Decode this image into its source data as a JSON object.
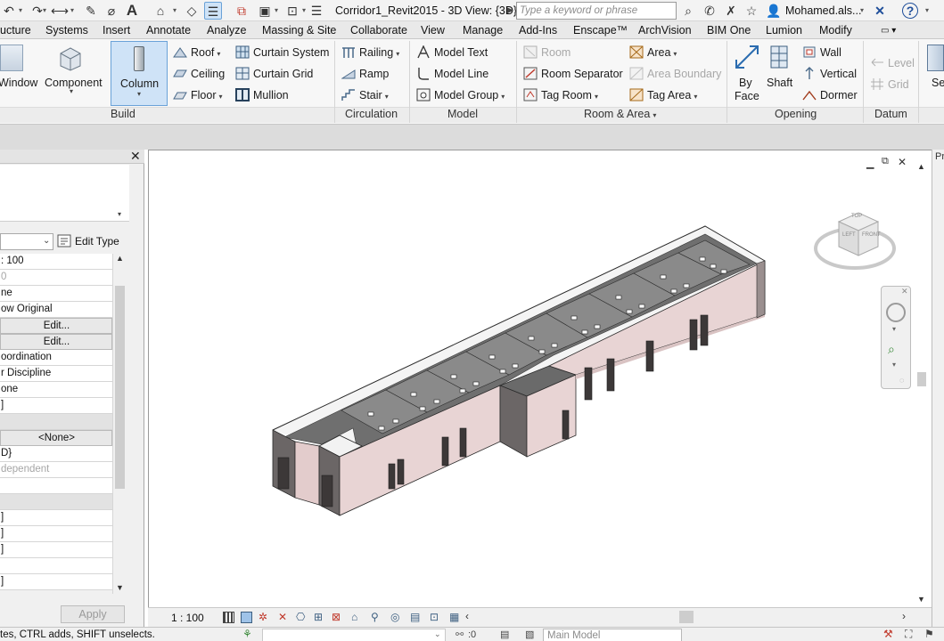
{
  "app": {
    "document_title": "Corridor1_Revit2015 - 3D View: {3D}",
    "search_placeholder": "Type a keyword or phrase",
    "user_name": "Mohamed.als..."
  },
  "tabs": [
    "ucture",
    "Systems",
    "Insert",
    "Annotate",
    "Analyze",
    "Massing & Site",
    "Collaborate",
    "View",
    "Manage",
    "Add-Ins",
    "Enscape™",
    "ArchVision",
    "BIM One",
    "Lumion",
    "Modify"
  ],
  "ribbon": {
    "build": {
      "label": "Build",
      "window": "Window",
      "component": "Component",
      "column": "Column",
      "roof": "Roof",
      "ceiling": "Ceiling",
      "floor": "Floor",
      "curtain_system": "Curtain System",
      "curtain_grid": "Curtain Grid",
      "mullion": "Mullion"
    },
    "circulation": {
      "label": "Circulation",
      "railing": "Railing",
      "ramp": "Ramp",
      "stair": "Stair"
    },
    "model": {
      "label": "Model",
      "model_text": "Model Text",
      "model_line": "Model Line",
      "model_group": "Model Group"
    },
    "room_area": {
      "label": "Room & Area",
      "room": "Room",
      "room_separator": "Room Separator",
      "tag_room": "Tag Room",
      "area": "Area",
      "area_boundary": "Area Boundary",
      "tag_area": "Tag Area"
    },
    "opening": {
      "label": "Opening",
      "by_face_1": "By",
      "by_face_2": "Face",
      "shaft": "Shaft",
      "wall": "Wall",
      "vertical": "Vertical",
      "dormer": "Dormer"
    },
    "datum": {
      "label": "Datum",
      "level": "Level",
      "grid": "Grid"
    },
    "set_partial": "Se"
  },
  "properties": {
    "edit_type": "Edit Type",
    "rows": [
      {
        "text": ": 100",
        "kind": "normal"
      },
      {
        "text": "0",
        "kind": "gray"
      },
      {
        "text": "ne",
        "kind": "normal"
      },
      {
        "text": "ow Original",
        "kind": "normal"
      },
      {
        "text": "Edit...",
        "kind": "btn"
      },
      {
        "text": "Edit...",
        "kind": "btn"
      },
      {
        "text": "oordination",
        "kind": "normal"
      },
      {
        "text": "r Discipline",
        "kind": "normal"
      },
      {
        "text": "one",
        "kind": "normal"
      },
      {
        "text": "]",
        "kind": "normal"
      },
      {
        "text": "",
        "kind": "group"
      },
      {
        "text": "<None>",
        "kind": "btn"
      },
      {
        "text": "D}",
        "kind": "normal"
      },
      {
        "text": "dependent",
        "kind": "gray"
      },
      {
        "text": "",
        "kind": "normal"
      },
      {
        "text": "",
        "kind": "group"
      },
      {
        "text": "]",
        "kind": "normal"
      },
      {
        "text": "]",
        "kind": "normal"
      },
      {
        "text": "]",
        "kind": "normal"
      },
      {
        "text": "",
        "kind": "normal"
      },
      {
        "text": "]",
        "kind": "normal"
      }
    ],
    "apply": "Apply"
  },
  "view": {
    "scale": "1 : 100",
    "viewcube_top": "TOP",
    "viewcube_left": "LEFT",
    "viewcube_front": "FRONT"
  },
  "statusbar": {
    "hint": "tes, CTRL adds, SHIFT unselects.",
    "zero": ":0",
    "model": "Main Model"
  },
  "colors": {
    "wall_pink": "#e8d4d4",
    "accent_blue": "#cfe3f7"
  }
}
